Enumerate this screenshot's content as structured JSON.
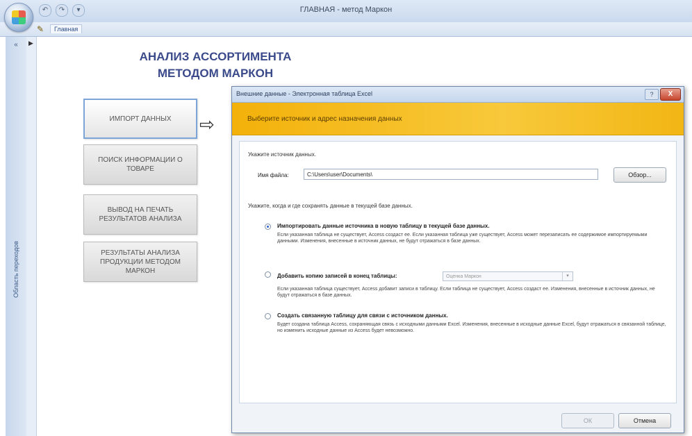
{
  "window": {
    "title": "ГЛАВНАЯ - метод Маркон"
  },
  "quick_access": {
    "save_glyph": "↶",
    "undo_glyph": "↷",
    "more_glyph": "▾"
  },
  "ribbon": {
    "home_tab": "Главная"
  },
  "navpane": {
    "label": "Область переходов",
    "toggle_glyph": "«"
  },
  "form": {
    "title_line1": "АНАЛИЗ АССОРТИМЕНТА",
    "title_line2": "МЕТОДОМ МАРКОН",
    "buttons": [
      "ИМПОРТ ДАННЫХ",
      "ПОИСК ИНФОРМАЦИИ О ТОВАРЕ",
      "ВЫВОД НА ПЕЧАТЬ РЕЗУЛЬТАТОВ АНАЛИЗА",
      "РЕЗУЛЬТАТЫ АНАЛИЗА ПРОДУКЦИИ МЕТОДОМ МАРКОН"
    ],
    "arrow_glyph": "⇨"
  },
  "dialog": {
    "title": "Внешние данные - Электронная таблица Excel",
    "help_glyph": "?",
    "close_glyph": "X",
    "banner": "Выберите источник и адрес назначения данных",
    "source_label": "Укажите источник данных.",
    "file_label": "Имя файла:",
    "file_value": "C:\\Users\\user\\Documents\\",
    "browse_label": "Обзор...",
    "dest_label": "Укажите, когда и где сохранять данные в текущей базе данных.",
    "options": [
      {
        "title": "Импортировать данные источника в новую таблицу в текущей базе данных.",
        "desc": "Если указанная таблица не существует, Access создаст ее. Если указанная таблица уже существует, Access может перезаписать ее содержимое импортируемыми данными. Изменения, внесенные в источник данных, не будут отражаться в базе данных.",
        "selected": true
      },
      {
        "title": "Добавить копию записей в конец таблицы:",
        "desc": "Если указанная таблица существует, Access добавит записи в таблицу. Если таблица не существует, Access создаст ее. Изменения, внесенные в источник данных, не будут отражаться в базе данных.",
        "selected": false,
        "combo_value": "Оценка Маркон"
      },
      {
        "title": "Создать связанную таблицу для связи с источником данных.",
        "desc": "Будет создана таблица Access, сохраняющая связь с исходными данными Excel. Изменения, внесенные в исходные данные Excel, будут отражаться в связанной таблице, но изменить исходные данные из Access будет невозможно.",
        "selected": false
      }
    ],
    "ok_label": "ОК",
    "cancel_label": "Отмена"
  }
}
